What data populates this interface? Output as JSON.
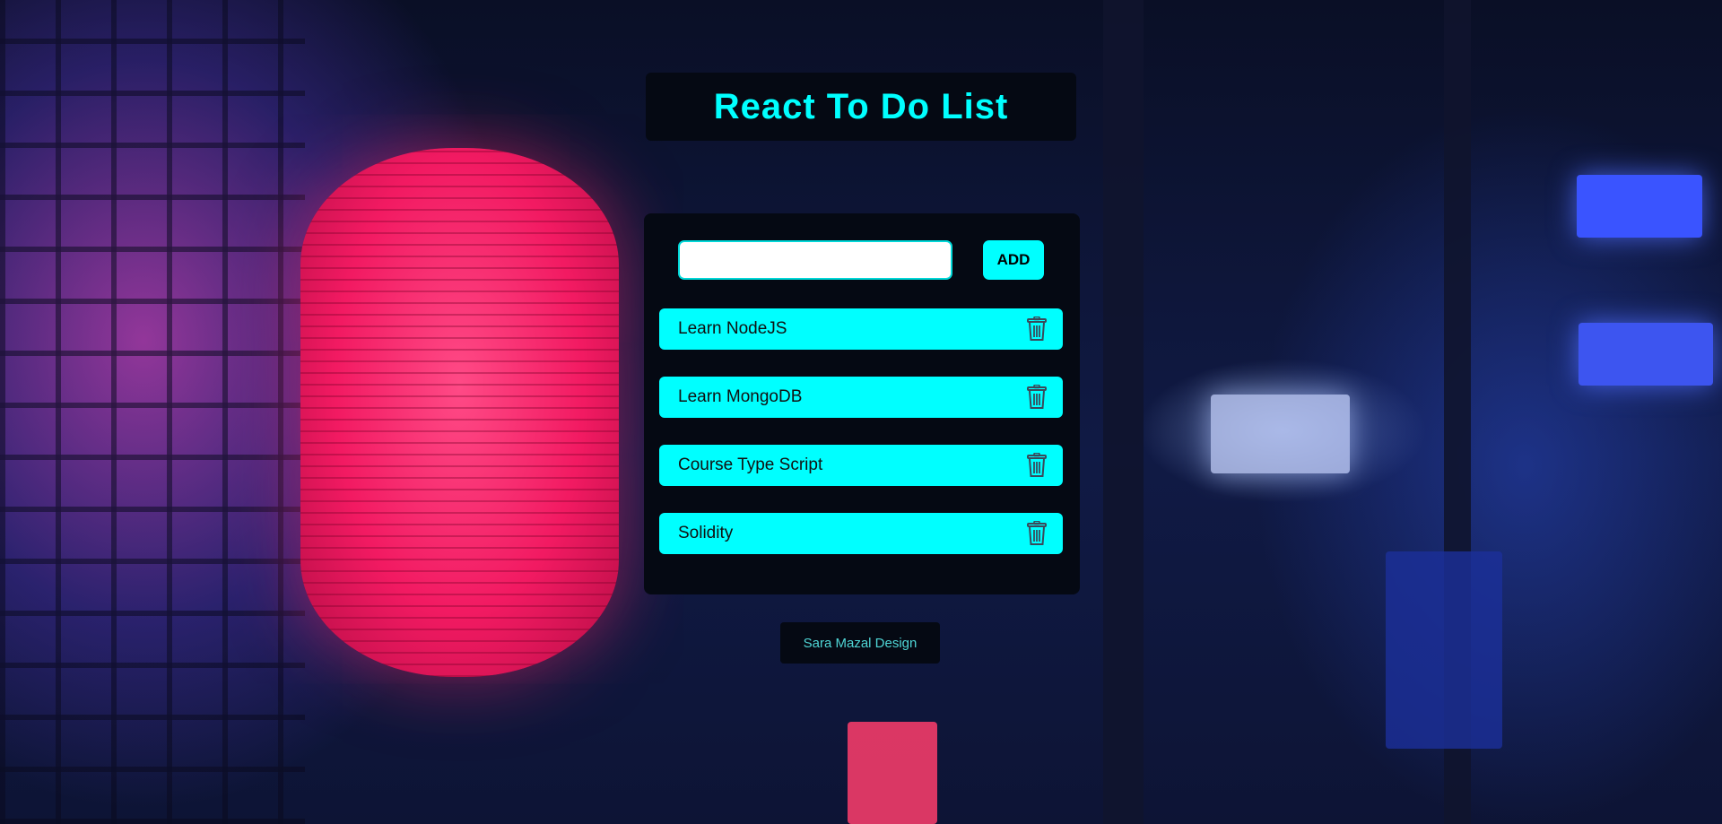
{
  "app": {
    "title": "React To Do List"
  },
  "form": {
    "input_value": "",
    "input_placeholder": "",
    "add_label": "ADD"
  },
  "todos": [
    {
      "text": "Learn NodeJS",
      "icon": "trash-icon"
    },
    {
      "text": "Learn MongoDB",
      "icon": "trash-icon"
    },
    {
      "text": "Course Type Script",
      "icon": "trash-icon"
    },
    {
      "text": "Solidity",
      "icon": "trash-icon"
    }
  ],
  "footer": {
    "credit": "Sara Mazal Design"
  },
  "colors": {
    "accent": "#00ffff",
    "panel": "#050913",
    "footer_text": "#4fd6d6"
  }
}
